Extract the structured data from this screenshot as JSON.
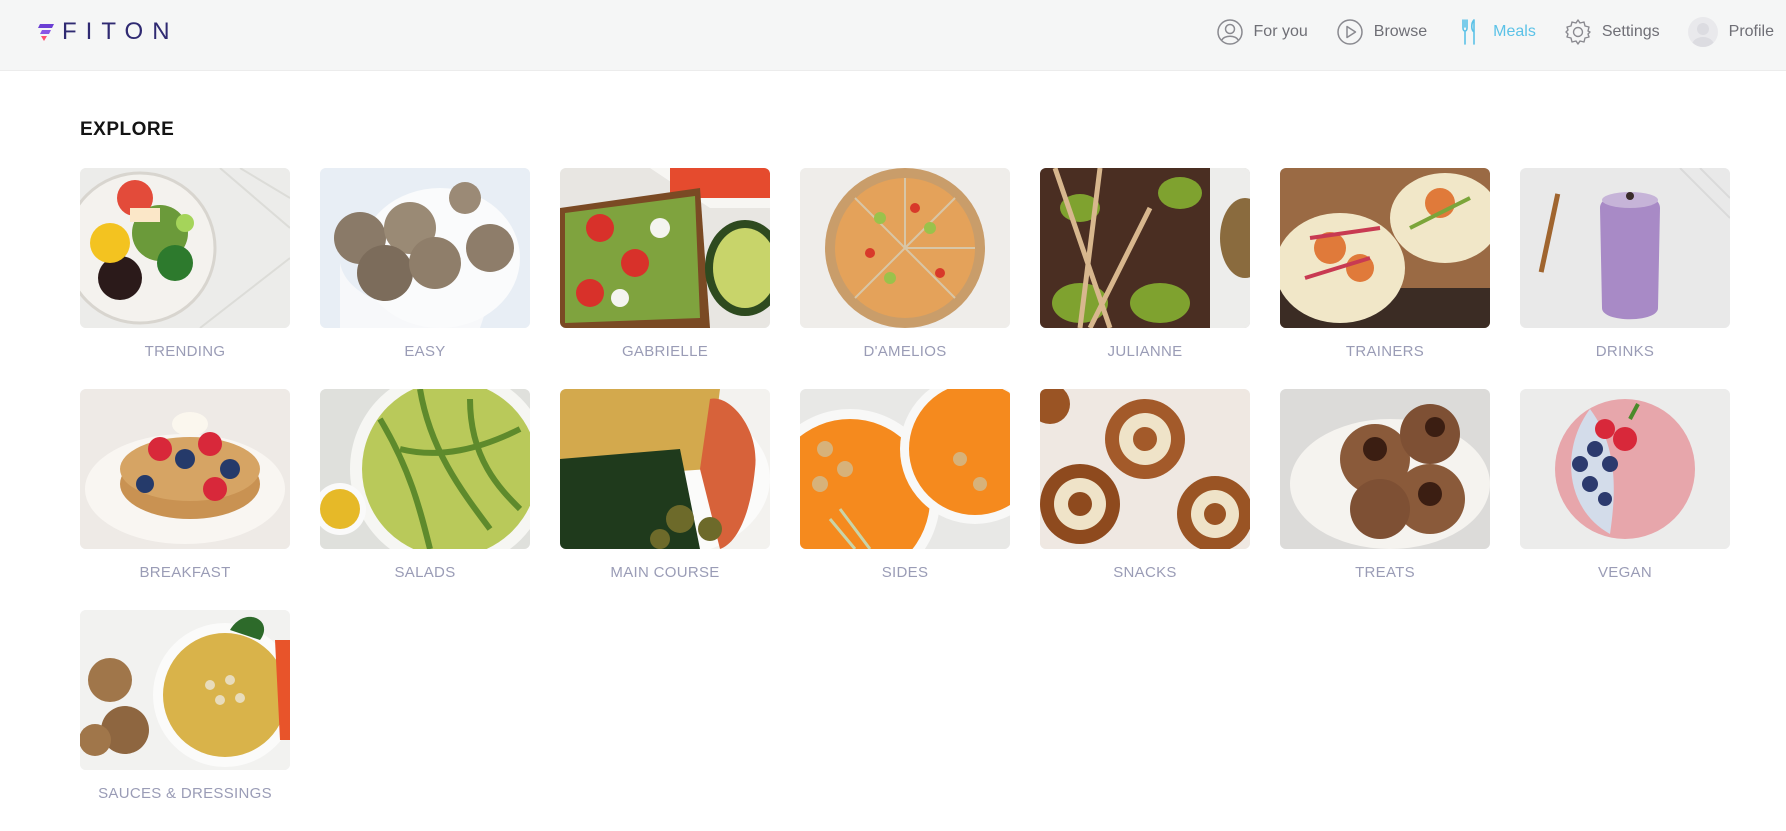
{
  "app": {
    "logo_text": "FITON"
  },
  "nav": {
    "items": [
      {
        "label": "For you",
        "icon": "user-circle-icon"
      },
      {
        "label": "Browse",
        "icon": "play-circle-icon"
      },
      {
        "label": "Meals",
        "icon": "utensils-icon"
      },
      {
        "label": "Settings",
        "icon": "gear-icon"
      },
      {
        "label": "Profile",
        "icon": "avatar"
      }
    ],
    "active_item": "Meals"
  },
  "main": {
    "section_title": "EXPLORE",
    "categories": [
      {
        "label": "TRENDING"
      },
      {
        "label": "EASY"
      },
      {
        "label": "GABRIELLE"
      },
      {
        "label": "D'AMELIOS"
      },
      {
        "label": "JULIANNE"
      },
      {
        "label": "TRAINERS"
      },
      {
        "label": "DRINKS"
      },
      {
        "label": "BREAKFAST"
      },
      {
        "label": "SALADS"
      },
      {
        "label": "MAIN COURSE"
      },
      {
        "label": "SIDES"
      },
      {
        "label": "SNACKS"
      },
      {
        "label": "TREATS"
      },
      {
        "label": "VEGAN"
      },
      {
        "label": "SAUCES & DRESSINGS"
      }
    ]
  },
  "colors": {
    "accent": "#5bc2e7",
    "logo": "#2f2a72",
    "nav_text": "#6f6f76",
    "card_label": "#9a9cb6",
    "header_bg": "#f5f6f6"
  }
}
